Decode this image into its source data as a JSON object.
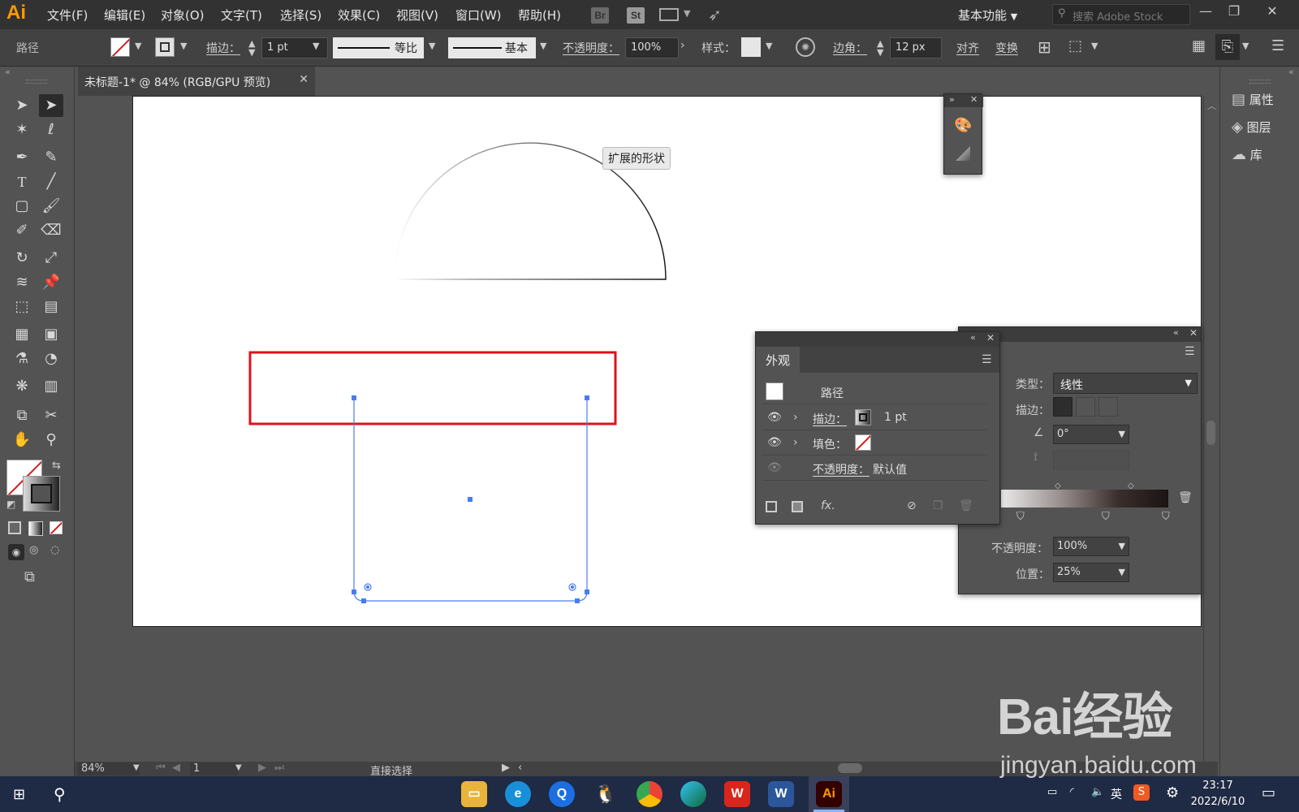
{
  "app": {
    "logo": "Ai"
  },
  "menu": [
    "文件(F)",
    "编辑(E)",
    "对象(O)",
    "文字(T)",
    "选择(S)",
    "效果(C)",
    "视图(V)",
    "窗口(W)",
    "帮助(H)"
  ],
  "menubar_icons": {
    "bridge": "Br",
    "stock": "St"
  },
  "workspace": "基本功能",
  "search_placeholder": "搜索 Adobe Stock",
  "control_bar": {
    "object_type": "路径",
    "stroke_label": "描边：",
    "stroke_weight": "1 pt",
    "profile_label": "等比",
    "brush_label": "基本",
    "opacity_label": "不透明度：",
    "opacity_value": "100%",
    "style_label": "样式：",
    "corner_label": "边角：",
    "corner_value": "12 px",
    "align_label": "对齐",
    "transform_label": "变换"
  },
  "document_tab": {
    "title": "未标题-1* @ 84% (RGB/GPU 预览)"
  },
  "canvas": {
    "tooltip": "扩展的形状"
  },
  "right_dock": {
    "items": [
      "属性",
      "图层",
      "库"
    ],
    "icons": [
      "properties-icon",
      "layers-icon",
      "libraries-icon"
    ]
  },
  "appearance_panel": {
    "tab": "外观",
    "object": "路径",
    "stroke_label": "描边：",
    "stroke_value": "1 pt",
    "fill_label": "填色：",
    "opacity_label": "不透明度：",
    "opacity_value": "默认值",
    "fx": "fx."
  },
  "gradient_panel": {
    "type_label": "类型：",
    "type_value": "线性",
    "stroke_label": "描边：",
    "angle_value": "0°",
    "opacity_label": "不透明度：",
    "opacity_value": "100%",
    "position_label": "位置：",
    "position_value": "25%"
  },
  "status_bar": {
    "zoom": "84%",
    "artboard": "1",
    "tool": "直接选择"
  },
  "taskbar": {
    "ime": "英",
    "time": "23:17",
    "date": "2022/6/10"
  },
  "watermark": {
    "line1": "Bai经验",
    "line2": "jingyan.baidu.com"
  },
  "colors": {
    "accent": "#ff9a00",
    "selection": "#4a7cf0",
    "highlight_box": "#e0101a",
    "taskbar": "#1f2a44"
  }
}
